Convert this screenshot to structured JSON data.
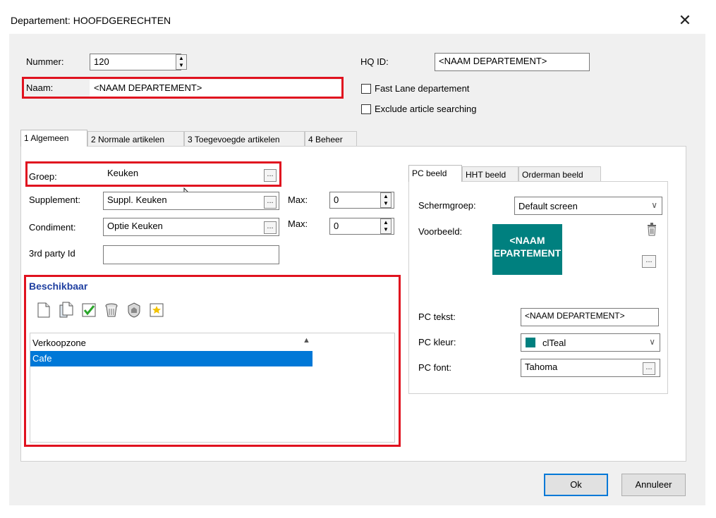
{
  "dialog": {
    "title": "Departement: HOOFDGERECHTEN",
    "close_label": "✕"
  },
  "header": {
    "nummer_label": "Nummer:",
    "nummer_value": "120",
    "naam_label": "Naam:",
    "naam_value": "<NAAM DEPARTEMENT>",
    "hqid_label": "HQ ID:",
    "hqid_value": "<NAAM DEPARTEMENT>",
    "fast_lane_label": "Fast Lane departement",
    "fast_lane_checked": false,
    "exclude_label": "Exclude article searching",
    "exclude_checked": false
  },
  "main_tabs": [
    {
      "label": "1 Algemeen",
      "active": true
    },
    {
      "label": "2 Normale artikelen",
      "active": false
    },
    {
      "label": "3 Toegevoegde artikelen",
      "active": false
    },
    {
      "label": "4 Beheer",
      "active": false
    }
  ],
  "general": {
    "groep_label": "Groep:",
    "groep_value": "Keuken",
    "supplement_label": "Supplement:",
    "supplement_value": "Suppl. Keuken",
    "supplement_max_label": "Max:",
    "supplement_max_value": "0",
    "condiment_label": "Condiment:",
    "condiment_value": "Optie Keuken",
    "condiment_max_label": "Max:",
    "condiment_max_value": "0",
    "third_party_label": "3rd party Id",
    "third_party_value": "",
    "ellipsis": "..."
  },
  "beschikbaar": {
    "title": "Beschikbaar",
    "toolbar_icons": [
      "new-document-icon",
      "copy-document-icon",
      "check-icon",
      "trash-icon",
      "shield-icon",
      "favorite-icon"
    ],
    "column_header": "Verkoopzone",
    "sort_indicator": "▲",
    "rows": [
      "Cafe"
    ]
  },
  "pc_tabs": [
    {
      "label": "PC beeld",
      "active": true
    },
    {
      "label": "HHT beeld",
      "active": false
    },
    {
      "label": "Orderman beeld",
      "active": false
    }
  ],
  "pc_beeld": {
    "schermgroep_label": "Schermgroep:",
    "schermgroep_value": "Default screen",
    "voorbeeld_label": "Voorbeeld:",
    "preview_line1": "<NAAM",
    "preview_line2": "EPARTEMENT",
    "preview_color": "#00807f",
    "pc_tekst_label": "PC tekst:",
    "pc_tekst_value": "<NAAM DEPARTEMENT>",
    "pc_kleur_label": "PC kleur:",
    "pc_kleur_value": "clTeal",
    "pc_font_label": "PC font:",
    "pc_font_value": "Tahoma",
    "ellipsis": "..."
  },
  "buttons": {
    "ok": "Ok",
    "cancel": "Annuleer"
  },
  "colors": {
    "highlight_box": "#e0121f",
    "selection": "#0078d7",
    "teal": "#00807f",
    "section_title": "#1f3fa0"
  }
}
